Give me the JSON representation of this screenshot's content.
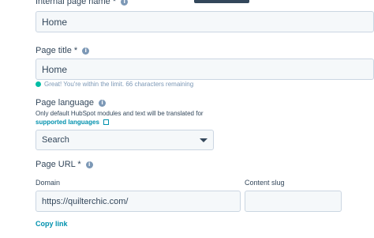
{
  "fields": {
    "internal_name": {
      "label": "Internal page name *",
      "value": "Home"
    },
    "page_title": {
      "label": "Page title *",
      "value": "Home",
      "hint": "Great! You're within the limit. 66 characters remaining"
    },
    "language": {
      "label": "Page language",
      "description": "Only default HubSpot modules and text will be translated for",
      "link": "supported languages",
      "select_value": "Search"
    },
    "page_url": {
      "label": "Page URL *",
      "domain_label": "Domain",
      "domain_value": "https://quilterchic.com/",
      "slug_label": "Content slug",
      "slug_value": ""
    }
  },
  "copy_link": "Copy link",
  "colors": {
    "accent": "#0091ae",
    "success": "#00bda5",
    "text": "#33475b",
    "input_bg": "#f5f8fa",
    "border": "#cbd6e2"
  }
}
